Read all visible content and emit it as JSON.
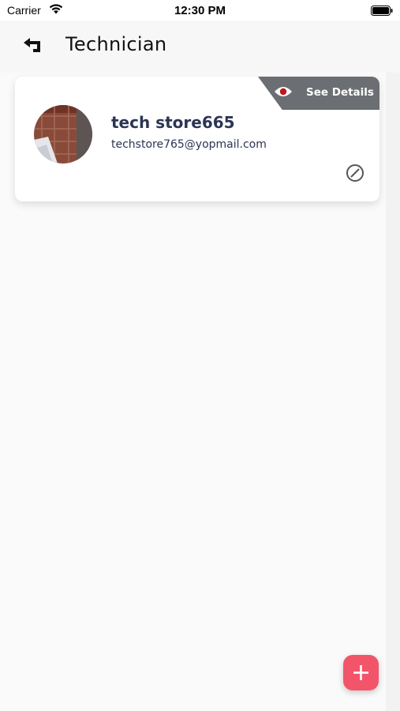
{
  "status_bar": {
    "carrier": "Carrier",
    "time": "12:30 PM"
  },
  "header": {
    "title": "Technician",
    "back_icon": "back-arrow-icon"
  },
  "technicians": [
    {
      "name": "tech store665",
      "email": "techstore765@yopmail.com",
      "details_label": "See Details",
      "status_icon": "disabled-circle-icon"
    }
  ],
  "fab": {
    "icon": "plus-icon"
  },
  "colors": {
    "accent": "#f2556a",
    "text_dark": "#2c3553",
    "ribbon": "#6b6e72",
    "eye_dot": "#c0151d"
  }
}
